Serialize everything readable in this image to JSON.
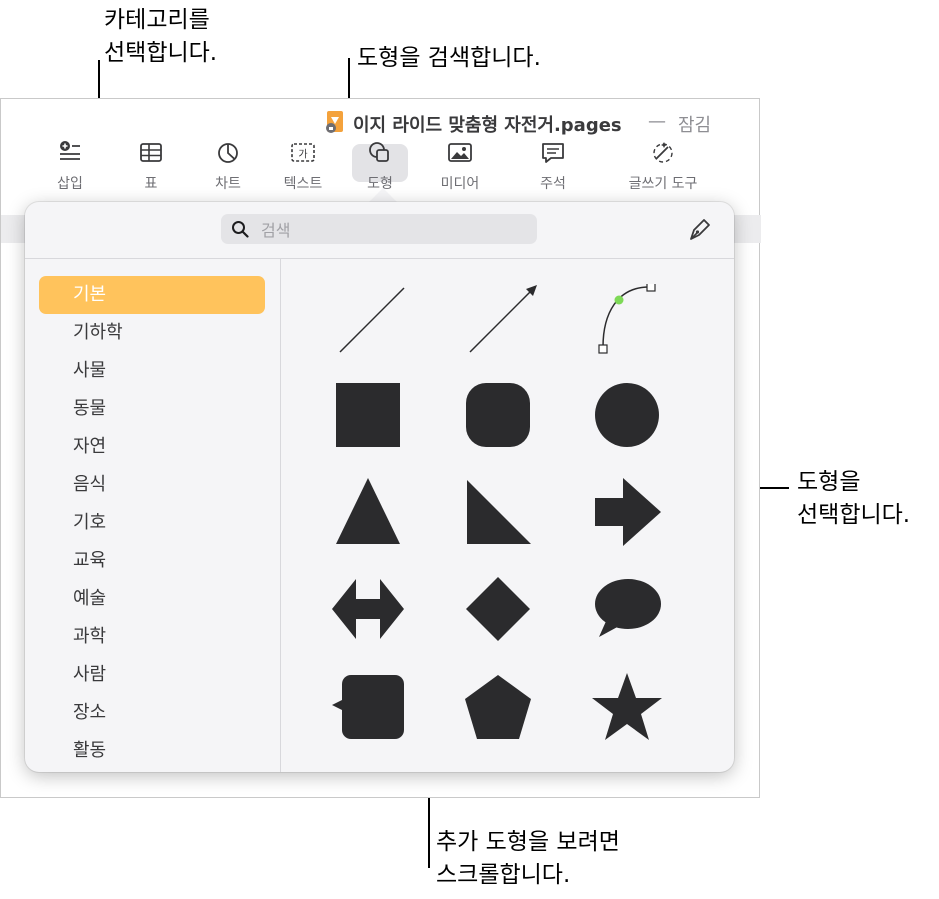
{
  "callouts": {
    "category": "카테고리를\n선택합니다.",
    "search": "도형을 검색합니다.",
    "select": "도형을\n선택합니다.",
    "scroll": "추가 도형을 보려면\n스크롤합니다."
  },
  "window": {
    "doc_title": "이지 라이드 맞춤형 자전거.pages",
    "separator": "—",
    "locked": "잠김"
  },
  "toolbar": [
    {
      "label": "삽입",
      "icon": "insert-icon"
    },
    {
      "label": "표",
      "icon": "table-icon"
    },
    {
      "label": "차트",
      "icon": "chart-icon"
    },
    {
      "label": "텍스트",
      "icon": "text-icon"
    },
    {
      "label": "도형",
      "icon": "shape-icon"
    },
    {
      "label": "미디어",
      "icon": "media-icon"
    },
    {
      "label": "주석",
      "icon": "comment-icon"
    },
    {
      "label": "글쓰기 도구",
      "icon": "writing-tools-icon"
    }
  ],
  "search": {
    "placeholder": "검색",
    "value": ""
  },
  "categories": [
    "기본",
    "기하학",
    "사물",
    "동물",
    "자연",
    "음식",
    "기호",
    "교육",
    "예술",
    "과학",
    "사람",
    "장소",
    "활동"
  ],
  "selected_category": "기본",
  "shapes": [
    "line",
    "arrow-line",
    "curve",
    "square",
    "rounded-square",
    "circle",
    "triangle",
    "right-triangle",
    "arrow",
    "double-arrow",
    "diamond",
    "speech-bubble",
    "callout-square",
    "pentagon",
    "star"
  ],
  "colors": {
    "accent": "#ffc35c",
    "shape_fill": "#2b2b2d",
    "curve_handle": "#7ed957"
  }
}
